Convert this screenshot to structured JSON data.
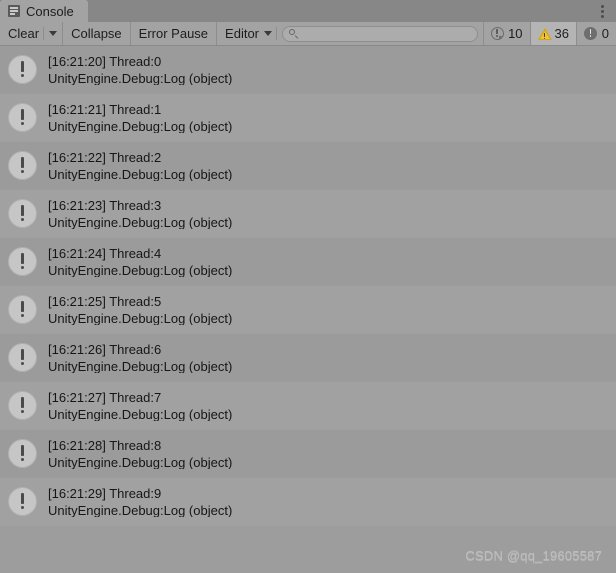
{
  "window": {
    "title": "Console",
    "tab_icon": "console-sheet-icon",
    "menu_icon": "kebab-menu-icon"
  },
  "toolbar": {
    "clear_label": "Clear",
    "clear_dropdown_icon": "chevron-down-icon",
    "collapse_label": "Collapse",
    "error_pause_label": "Error Pause",
    "editor_label": "Editor",
    "editor_dropdown_icon": "chevron-down-icon",
    "search": {
      "icon": "search-icon",
      "value": "",
      "placeholder": ""
    },
    "counters": [
      {
        "name": "log-counter",
        "icon": "log-bubble-icon",
        "count": "10",
        "active": false,
        "color": "#6b6b6b"
      },
      {
        "name": "warning-counter",
        "icon": "warning-triangle-icon",
        "count": "36",
        "active": true,
        "color": "#e9c33a"
      },
      {
        "name": "error-counter",
        "icon": "error-bubble-icon",
        "count": "0",
        "active": false,
        "color": "#6e6e6e"
      }
    ]
  },
  "log_entries": [
    {
      "icon": "log-bubble-icon",
      "message": "[16:21:20] Thread:0",
      "stacktrace": "UnityEngine.Debug:Log (object)"
    },
    {
      "icon": "log-bubble-icon",
      "message": "[16:21:21] Thread:1",
      "stacktrace": "UnityEngine.Debug:Log (object)"
    },
    {
      "icon": "log-bubble-icon",
      "message": "[16:21:22] Thread:2",
      "stacktrace": "UnityEngine.Debug:Log (object)"
    },
    {
      "icon": "log-bubble-icon",
      "message": "[16:21:23] Thread:3",
      "stacktrace": "UnityEngine.Debug:Log (object)"
    },
    {
      "icon": "log-bubble-icon",
      "message": "[16:21:24] Thread:4",
      "stacktrace": "UnityEngine.Debug:Log (object)"
    },
    {
      "icon": "log-bubble-icon",
      "message": "[16:21:25] Thread:5",
      "stacktrace": "UnityEngine.Debug:Log (object)"
    },
    {
      "icon": "log-bubble-icon",
      "message": "[16:21:26] Thread:6",
      "stacktrace": "UnityEngine.Debug:Log (object)"
    },
    {
      "icon": "log-bubble-icon",
      "message": "[16:21:27] Thread:7",
      "stacktrace": "UnityEngine.Debug:Log (object)"
    },
    {
      "icon": "log-bubble-icon",
      "message": "[16:21:28] Thread:8",
      "stacktrace": "UnityEngine.Debug:Log (object)"
    },
    {
      "icon": "log-bubble-icon",
      "message": "[16:21:29] Thread:9",
      "stacktrace": "UnityEngine.Debug:Log (object)"
    }
  ],
  "watermark": {
    "text": "CSDN @qq_19605587"
  },
  "colors": {
    "window_bg": "#9d9d9d",
    "tabbar_bg": "#878787",
    "tab_active_bg": "#a3a3a3",
    "toolbar_bg": "#a3a3a3",
    "row_even": "#9b9b9b",
    "row_odd": "#a1a1a1",
    "text": "#161616",
    "warning": "#e9c33a"
  }
}
